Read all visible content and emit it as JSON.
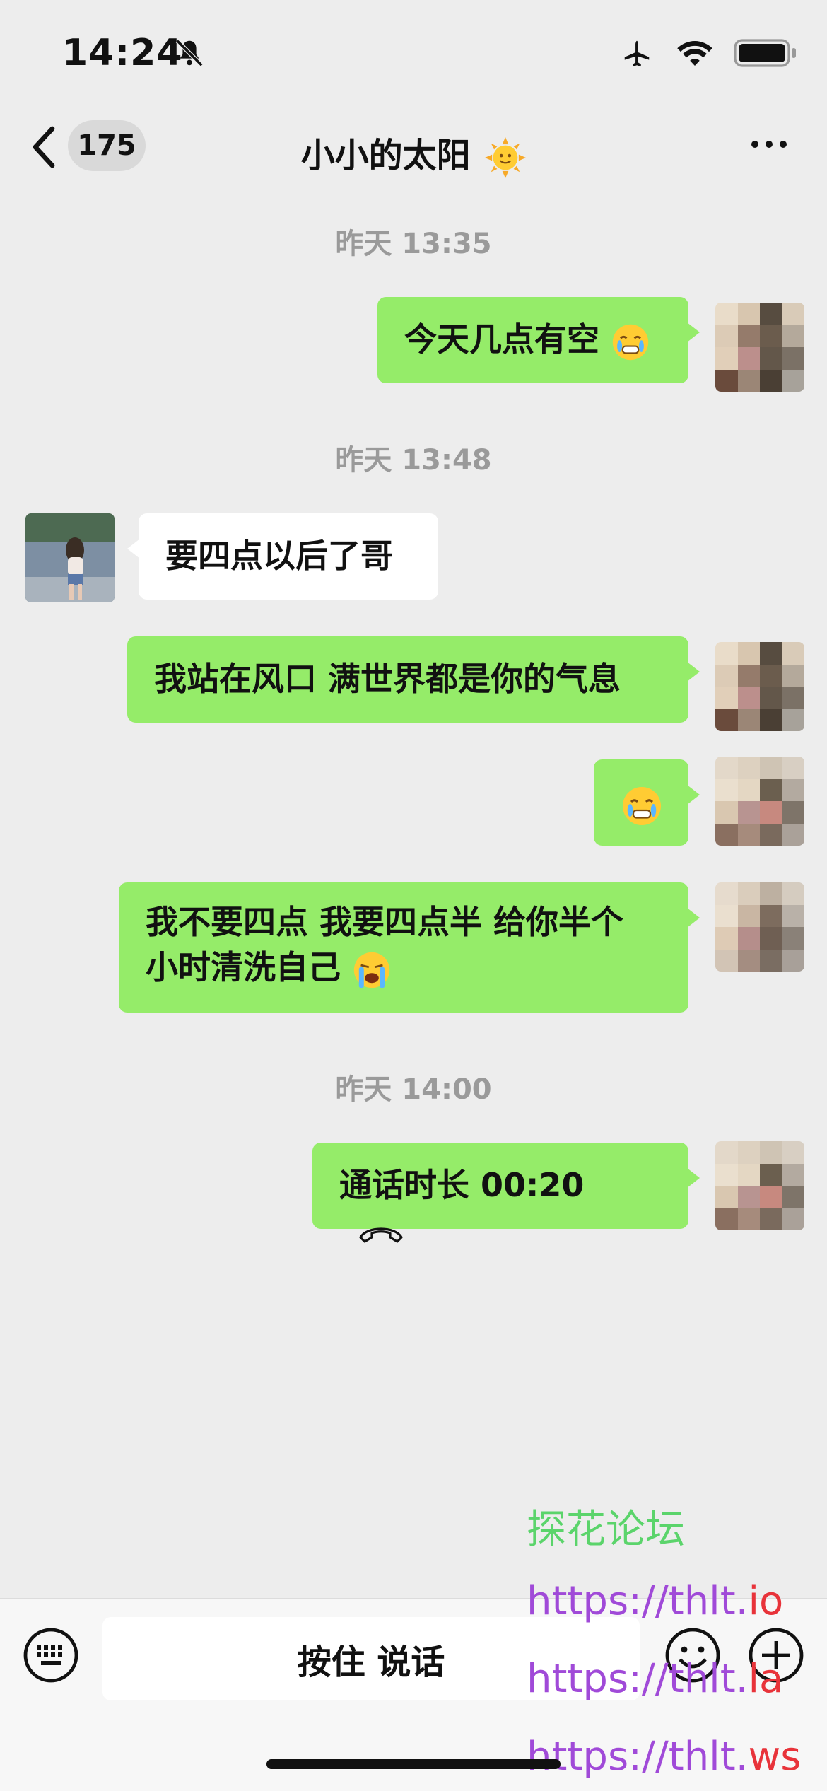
{
  "status_bar": {
    "time": "14:24",
    "icons": [
      "bell-off-icon",
      "airplane-icon",
      "wifi-icon",
      "battery-icon"
    ]
  },
  "header": {
    "unread_count": "175",
    "title": "小小的太阳",
    "title_emoji": "sun-face"
  },
  "messages": [
    {
      "type": "timestamp",
      "text": "昨天 13:35"
    },
    {
      "type": "text",
      "from": "me",
      "text": "今天几点有空",
      "emoji": "crying-face"
    },
    {
      "type": "timestamp",
      "text": "昨天 13:48"
    },
    {
      "type": "text",
      "from": "friend",
      "text": "要四点以后了哥"
    },
    {
      "type": "text",
      "from": "me",
      "text": "我站在风口 满世界都是你的气息"
    },
    {
      "type": "emoji",
      "from": "me",
      "emoji": "crying-face"
    },
    {
      "type": "text",
      "from": "me",
      "line1": "我不要四点 我要四点半 给你半个",
      "line2": "小时清洗自己",
      "emoji": "loudly-crying-face"
    },
    {
      "type": "timestamp",
      "text": "昨天 14:00"
    },
    {
      "type": "call",
      "from": "me",
      "text": "通话时长 00:20"
    }
  ],
  "input_bar": {
    "voice_label": "按住 说话"
  },
  "watermark": {
    "title": "探花论坛",
    "links": [
      {
        "prefix": "https://thlt.",
        "suffix": "io"
      },
      {
        "prefix": "https://thlt.",
        "suffix": "la"
      },
      {
        "prefix": "https://thlt.",
        "suffix": "ws"
      }
    ]
  },
  "colors": {
    "background": "#ededed",
    "my_bubble": "#95ec69",
    "their_bubble": "#ffffff",
    "timestamp": "#9a9a9a",
    "watermark_title": "#5bd46b",
    "watermark_link": "#a04ad8",
    "watermark_suffix": "#e8333a"
  }
}
